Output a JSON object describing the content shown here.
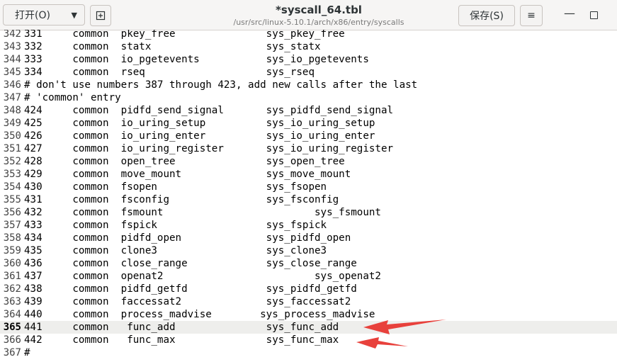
{
  "toolbar": {
    "open_label": "打开(O)",
    "save_label": "保存(S)",
    "menu_icon": "≡"
  },
  "title": {
    "filename": "*syscall_64.tbl",
    "path": "/usr/src/linux-5.10.1/arch/x86/entry/syscalls"
  },
  "lines": [
    {
      "n": "342",
      "text": "331     common  pkey_free               sys_pkey_free"
    },
    {
      "n": "343",
      "text": "332     common  statx                   sys_statx"
    },
    {
      "n": "344",
      "text": "333     common  io_pgetevents           sys_io_pgetevents"
    },
    {
      "n": "345",
      "text": "334     common  rseq                    sys_rseq"
    },
    {
      "n": "346",
      "text": "# don't use numbers 387 through 423, add new calls after the last"
    },
    {
      "n": "347",
      "text": "# 'common' entry"
    },
    {
      "n": "348",
      "text": "424     common  pidfd_send_signal       sys_pidfd_send_signal"
    },
    {
      "n": "349",
      "text": "425     common  io_uring_setup          sys_io_uring_setup"
    },
    {
      "n": "350",
      "text": "426     common  io_uring_enter          sys_io_uring_enter"
    },
    {
      "n": "351",
      "text": "427     common  io_uring_register       sys_io_uring_register"
    },
    {
      "n": "352",
      "text": "428     common  open_tree               sys_open_tree"
    },
    {
      "n": "353",
      "text": "429     common  move_mount              sys_move_mount"
    },
    {
      "n": "354",
      "text": "430     common  fsopen                  sys_fsopen"
    },
    {
      "n": "355",
      "text": "431     common  fsconfig                sys_fsconfig"
    },
    {
      "n": "356",
      "text": "432     common  fsmount                         sys_fsmount"
    },
    {
      "n": "357",
      "text": "433     common  fspick                  sys_fspick"
    },
    {
      "n": "358",
      "text": "434     common  pidfd_open              sys_pidfd_open"
    },
    {
      "n": "359",
      "text": "435     common  clone3                  sys_clone3"
    },
    {
      "n": "360",
      "text": "436     common  close_range             sys_close_range"
    },
    {
      "n": "361",
      "text": "437     common  openat2                         sys_openat2"
    },
    {
      "n": "362",
      "text": "438     common  pidfd_getfd             sys_pidfd_getfd"
    },
    {
      "n": "363",
      "text": "439     common  faccessat2              sys_faccessat2"
    },
    {
      "n": "364",
      "text": "440     common  process_madvise        sys_process_madvise"
    },
    {
      "n": "365",
      "text": "441     common   func_add               sys_func_add",
      "current": true
    },
    {
      "n": "366",
      "text": "442     common   func_max               sys_func_max"
    },
    {
      "n": "367",
      "text": "#"
    }
  ],
  "annotation_color": "#e8413c"
}
